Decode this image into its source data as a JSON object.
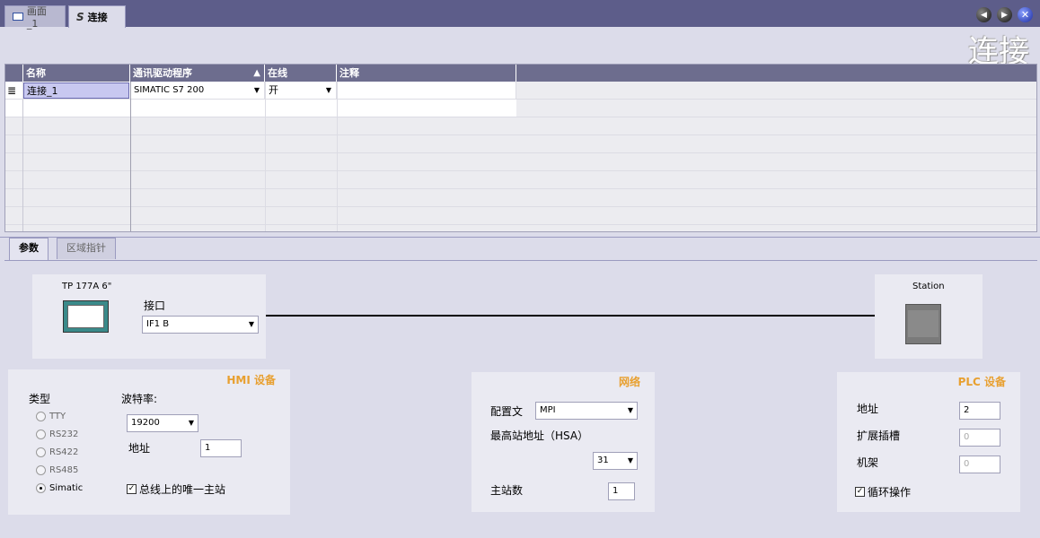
{
  "tabs": [
    {
      "label": "画面_1",
      "icon": "screen-icon"
    },
    {
      "label": "连接",
      "icon": "connection-icon"
    }
  ],
  "window_controls": {
    "prev": "◀",
    "next": "▶",
    "close": "✕"
  },
  "editor_title": "连接",
  "table": {
    "columns": [
      "名称",
      "通讯驱动程序",
      "在线",
      "注释"
    ],
    "rows": [
      {
        "name": "连接_1",
        "driver": "SIMATIC S7 200",
        "online": "开",
        "comment": ""
      }
    ]
  },
  "property_tabs": [
    "参数",
    "区域指针"
  ],
  "hmi_device": {
    "name": "TP 177A 6\"",
    "interface_label": "接口",
    "interface_value": "IF1 B"
  },
  "plc_station": {
    "name": "Station"
  },
  "hmi_section": {
    "title": "HMI 设备",
    "type_label": "类型",
    "types": [
      "TTY",
      "RS232",
      "RS422",
      "RS485",
      "Simatic"
    ],
    "selected_type": "Simatic",
    "baud_label": "波特率:",
    "baud_value": "19200",
    "address_label": "地址",
    "address_value": "1",
    "only_master_label": "总线上的唯一主站",
    "only_master_checked": true
  },
  "network_section": {
    "title": "网络",
    "profile_label": "配置文",
    "profile_value": "MPI",
    "hsa_label": "最高站地址（HSA）",
    "hsa_value": "31",
    "masters_label": "主站数",
    "masters_value": "1"
  },
  "plc_section": {
    "title": "PLC 设备",
    "address_label": "地址",
    "address_value": "2",
    "slot_label": "扩展插槽",
    "slot_value": "0",
    "rack_label": "机架",
    "rack_value": "0",
    "cyclic_label": "循环操作",
    "cyclic_checked": true
  },
  "colors": {
    "accent": "#e8a030",
    "header": "#6d6d8e",
    "topbar": "#5d5d8a"
  }
}
